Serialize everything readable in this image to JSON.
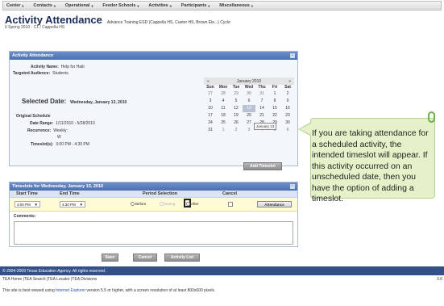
{
  "nav": {
    "items": [
      {
        "label": "Center"
      },
      {
        "label": "Contacts"
      },
      {
        "label": "Operational"
      },
      {
        "label": "Feeder Schools"
      },
      {
        "label": "Activities"
      },
      {
        "label": "Participants"
      },
      {
        "label": "Miscellaneous"
      }
    ]
  },
  "page": {
    "title": "Activity Attendance",
    "context": "Advance Training ESD (Cappella HS, Cueter HS, Brown Ele...) Cycle",
    "breadcrumb": "6 Spring 2010 - C1 / Cappella HS"
  },
  "attendance": {
    "header": "Activity Attendance",
    "activity_name_label": "Activity Name:",
    "activity_name": "Help for Haiti",
    "audience_label": "Targeted Audience:",
    "audience": "Students",
    "selected_date_label": "Selected Date:",
    "selected_date": "Wednesday, January 13, 2010",
    "original_schedule_label": "Original Schedule",
    "date_range_label": "Date Range:",
    "date_range": "1/11/2010 - 5/28/2010",
    "recurrence_label": "Recurrence:",
    "recurrence": "Weekly:",
    "recurrence_day": "W",
    "timeslots_label": "Timeslot(s):",
    "timeslots": "3:00 PM - 4:30 PM",
    "add_timeslot": "Add Timeslot"
  },
  "calendar": {
    "prev": "«",
    "next": "»",
    "month": "January 2010",
    "dows": [
      "Sun",
      "Mon",
      "Tue",
      "Wed",
      "Thu",
      "Fri",
      "Sat"
    ],
    "weeks": [
      [
        "27",
        "28",
        "29",
        "30",
        "31",
        "1",
        "2"
      ],
      [
        "3",
        "4",
        "5",
        "6",
        "7",
        "8",
        "9"
      ],
      [
        "10",
        "11",
        "12",
        "13",
        "14",
        "15",
        "16"
      ],
      [
        "17",
        "18",
        "19",
        "20",
        "21",
        "22",
        "23"
      ],
      [
        "24",
        "25",
        "26",
        "27",
        "28",
        "29",
        "30"
      ],
      [
        "31",
        "1",
        "2",
        "3",
        "4",
        "5",
        "6"
      ]
    ],
    "tooltip": "January 13"
  },
  "timeslots": {
    "header": "Timeslots for Wednesday, January 13, 2010",
    "col_start": "Start Time",
    "col_end": "End Time",
    "col_period": "Period Selection",
    "col_cancel": "Cancel",
    "start_time": "3:00 PM",
    "end_time": "4:30 PM",
    "opt_before": "Before",
    "opt_during": "During",
    "opt_after": "After",
    "attendance_btn": "Attendance",
    "comments_label": "Comments:"
  },
  "actions": {
    "save": "Save",
    "cancel": "Cancel",
    "activity_list": "Activity List"
  },
  "callout": {
    "text": "If you are taking attendance for a scheduled activity, the intended timeslot will appear. If this activity occurred on an unscheduled date, then you have the option of adding a timeslot."
  },
  "footer": {
    "copyright": "© 2004-2009 Texas Education Agency. All rights reserved.",
    "links": "TEA Home |TEA Search |TEA Locator |TEA Divisions",
    "version": "3.0",
    "note_pre": "This site is best viewed using ",
    "note_link": "Internet Explorer",
    "note_post": " version 5.5 or higher, with a screen resolution of at least 800x600 pixels."
  }
}
